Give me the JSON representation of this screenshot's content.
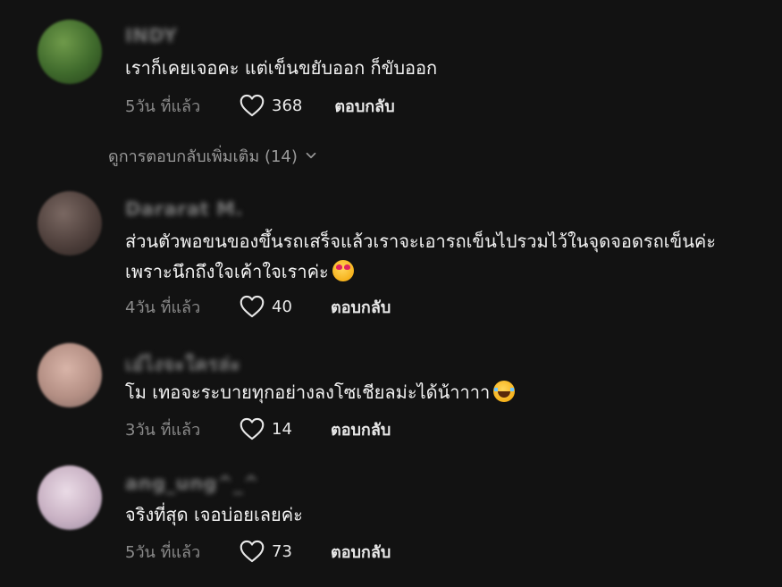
{
  "comments": [
    {
      "username": "INDY",
      "text": "เราก็เคยเจอคะ แต่เข็นขยับออก ก็ขับออก",
      "emoji": "",
      "time": "5วัน ที่แล้ว",
      "likes": "368",
      "reply_label": "ตอบกลับ",
      "avatar_color": "#3f6a2c"
    },
    {
      "username": "Dararat M.",
      "text": "ส่วนตัวพอขนของขึ้นรถเสร็จแล้วเราจะเอารถเข็นไปรวมไว้ในจุดจอดรถเข็นค่ะ เพราะนึกถึงใจเค้าใจเราค่ะ",
      "emoji": "smiling-face-with-hearts-emoji",
      "time": "4วัน ที่แล้ว",
      "likes": "40",
      "reply_label": "ตอบกลับ",
      "avatar_color": "#5a4a46"
    },
    {
      "username": "เอ๋ไงจะใครล่ะ",
      "text": "โม เทอจะระบายทุกอย่างลงโซเชียลม่ะได้น้าาาา",
      "emoji": "face-with-tears-of-joy-emoji",
      "time": "3วัน ที่แล้ว",
      "likes": "14",
      "reply_label": "ตอบกลับ",
      "avatar_color": "#b89a8e"
    },
    {
      "username": "ang_ung^_^",
      "text": "จริงที่สุด เจอบ่อยเลยค่ะ",
      "emoji": "",
      "time": "5วัน ที่แล้ว",
      "likes": "73",
      "reply_label": "ตอบกลับ",
      "avatar_color": "#c9b2c4"
    }
  ],
  "view_more": {
    "label": "ดูการตอบกลับเพิ่มเติม (14)"
  },
  "icons": {
    "like": "heart-outline-icon",
    "expand": "chevron-down-icon"
  }
}
